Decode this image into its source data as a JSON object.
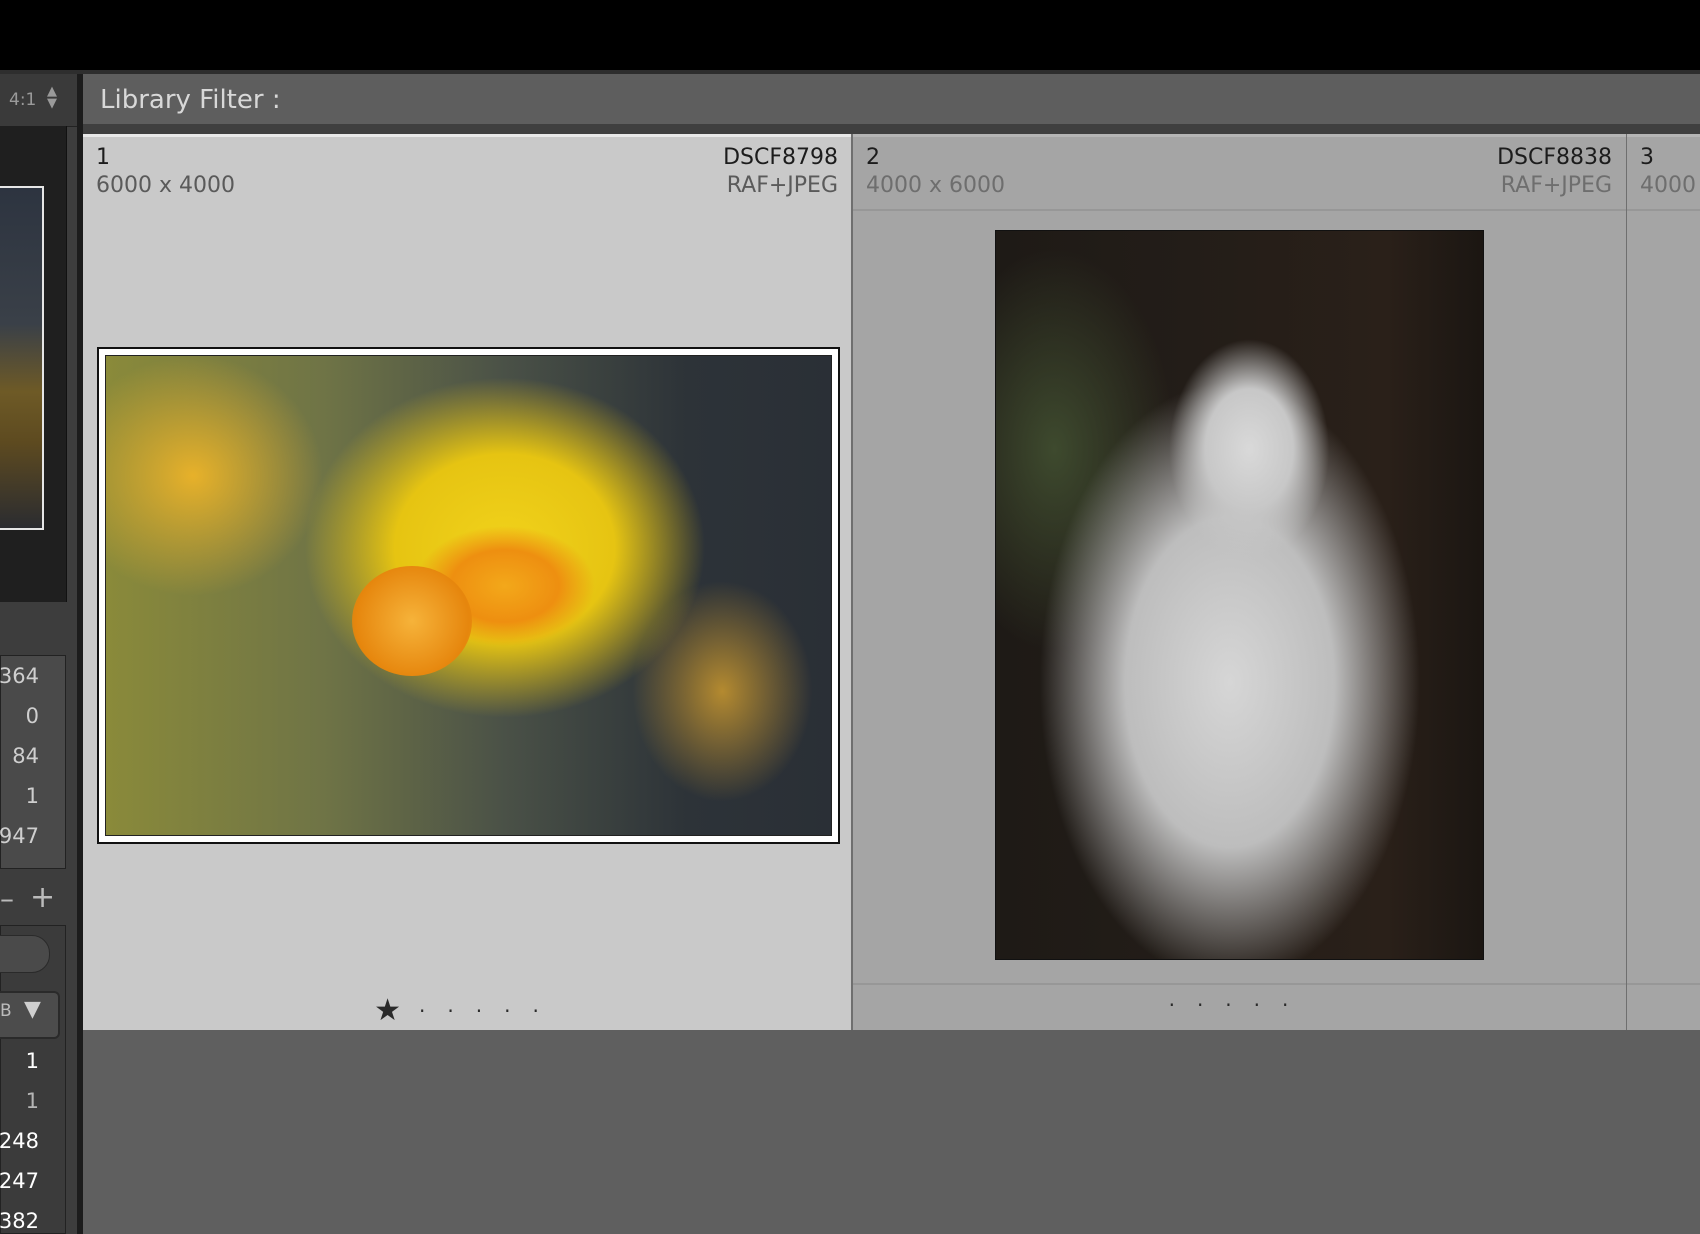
{
  "left_panel": {
    "zoom_label": "4:1",
    "stats": [
      "364",
      "0",
      "84",
      "1",
      "947"
    ],
    "lower_values": [
      {
        "text": "1",
        "color": "#ffffff"
      },
      {
        "text": "1",
        "color": "#b5b5b5"
      },
      {
        "text": "248",
        "color": "#ffffff"
      },
      {
        "text": "247",
        "color": "#ffffff"
      },
      {
        "text": "382",
        "color": "#ffffff"
      }
    ],
    "preset_label": "B"
  },
  "filter_bar": {
    "label": "Library Filter :"
  },
  "grid": {
    "cells": [
      {
        "index": "1",
        "dims": "6000 x 4000",
        "filename": "DSCF8798",
        "filetype": "RAF+JPEG",
        "rating_stars": 1,
        "selected": true,
        "thumbnail": "yellow daffodil flower"
      },
      {
        "index": "2",
        "dims": "4000 x 6000",
        "filename": "DSCF8838",
        "filetype": "RAF+JPEG",
        "rating_stars": 0,
        "selected": false,
        "thumbnail": "white marble statue of woman"
      },
      {
        "index": "3",
        "dims": "4000",
        "filename": "",
        "filetype": "",
        "selected": false
      }
    ]
  },
  "colors": {
    "selected_cell": "#c9c9c9",
    "unselected_cell": "#a5a5a5",
    "background": "#5f5f5f",
    "title_bar": "#000000"
  }
}
